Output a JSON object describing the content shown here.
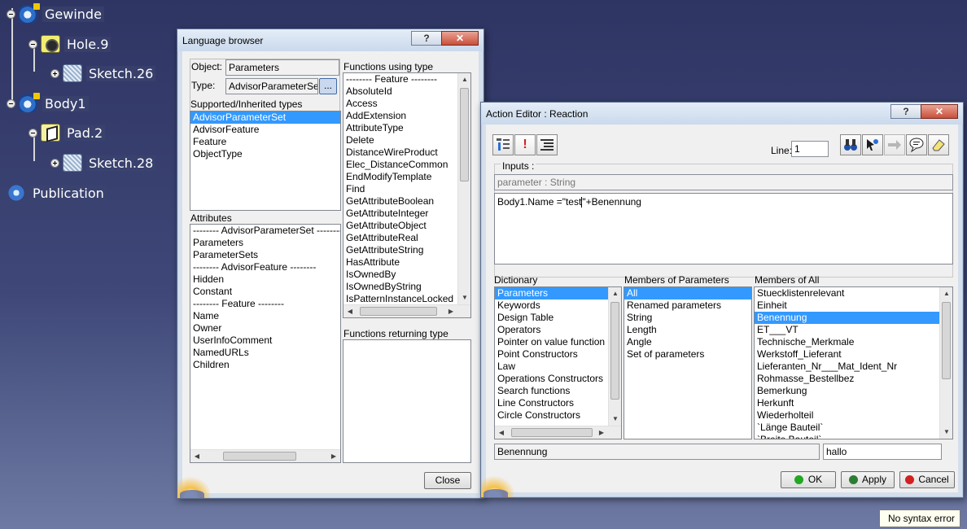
{
  "tree": {
    "nodes": [
      {
        "label": "Gewinde",
        "icon": "gear-icon"
      },
      {
        "label": "Hole.9",
        "icon": "hole-icon"
      },
      {
        "label": "Sketch.26",
        "icon": "sketch-icon"
      },
      {
        "label": "Body1",
        "icon": "gear-icon"
      },
      {
        "label": "Pad.2",
        "icon": "pad-icon"
      },
      {
        "label": "Sketch.28",
        "icon": "sketch-icon"
      },
      {
        "label": "Publication",
        "icon": "publication-icon"
      }
    ]
  },
  "language_browser": {
    "title": "Language browser",
    "help_label": "?",
    "close_label": "✕",
    "object_label": "Object:",
    "object_value": "Parameters",
    "type_label": "Type:",
    "type_value": "AdvisorParameterSet",
    "browse_label": "...",
    "supported_label": "Supported/Inherited types",
    "supported_items": [
      "AdvisorParameterSet",
      "AdvisorFeature",
      "Feature",
      "ObjectType"
    ],
    "attributes_label": "Attributes",
    "attributes_items": [
      "-------- AdvisorParameterSet --------",
      "Parameters",
      "ParameterSets",
      "-------- AdvisorFeature --------",
      "Hidden",
      "Constant",
      "-------- Feature --------",
      "Name",
      "Owner",
      "UserInfoComment",
      "NamedURLs",
      "Children"
    ],
    "functions_using_label": "Functions using type",
    "functions_using_items": [
      "-------- Feature --------",
      "AbsoluteId",
      "Access",
      "AddExtension",
      "AttributeType",
      "Delete",
      "DistanceWireProduct",
      "Elec_DistanceCommon",
      "EndModifyTemplate",
      "Find",
      "GetAttributeBoolean",
      "GetAttributeInteger",
      "GetAttributeObject",
      "GetAttributeReal",
      "GetAttributeString",
      "HasAttribute",
      "IsOwnedBy",
      "IsOwnedByString",
      "IsPatternInstanceLocked"
    ],
    "functions_returning_label": "Functions returning type",
    "close_button": "Close"
  },
  "action_editor": {
    "title": "Action Editor : Reaction",
    "help_label": "?",
    "close_label": "✕",
    "line_label": "Line:",
    "line_value": "1",
    "inputs_label": "Inputs :",
    "inputs_value": "parameter : String",
    "code_before_cursor": "Body1.Name =\"test",
    "code_after_cursor": "\"+Benennung",
    "dictionary_label": "Dictionary",
    "dictionary_items": [
      "Parameters",
      "Keywords",
      "Design Table",
      "Operators",
      "Pointer on value function",
      "Point Constructors",
      "Law",
      "Operations Constructors",
      "Search functions",
      "Line Constructors",
      "Circle Constructors"
    ],
    "members_params_label": "Members of Parameters",
    "members_params_items": [
      "All",
      "Renamed parameters",
      "String",
      "Length",
      "Angle",
      "Set of parameters"
    ],
    "members_all_label": "Members of All",
    "members_all_items": [
      "Stuecklistenrelevant",
      "Einheit",
      "Benennung",
      "ET___VT",
      "Technische_Merkmale",
      "Werkstoff_Lieferant",
      "Lieferanten_Nr___Mat_Ident_Nr",
      "Rohmasse_Bestellbez",
      "Bemerkung",
      "Herkunft",
      "Wiederholteil",
      "`Länge Bauteil`",
      "`Breite Bauteil`"
    ],
    "selected_name": "Benennung",
    "selected_value": "hallo",
    "ok_label": "OK",
    "apply_label": "Apply",
    "cancel_label": "Cancel",
    "colors": {
      "ok": "#22a822",
      "apply": "#2e7d32",
      "cancel": "#d32020"
    }
  },
  "status": {
    "tooltip": "No syntax error"
  }
}
